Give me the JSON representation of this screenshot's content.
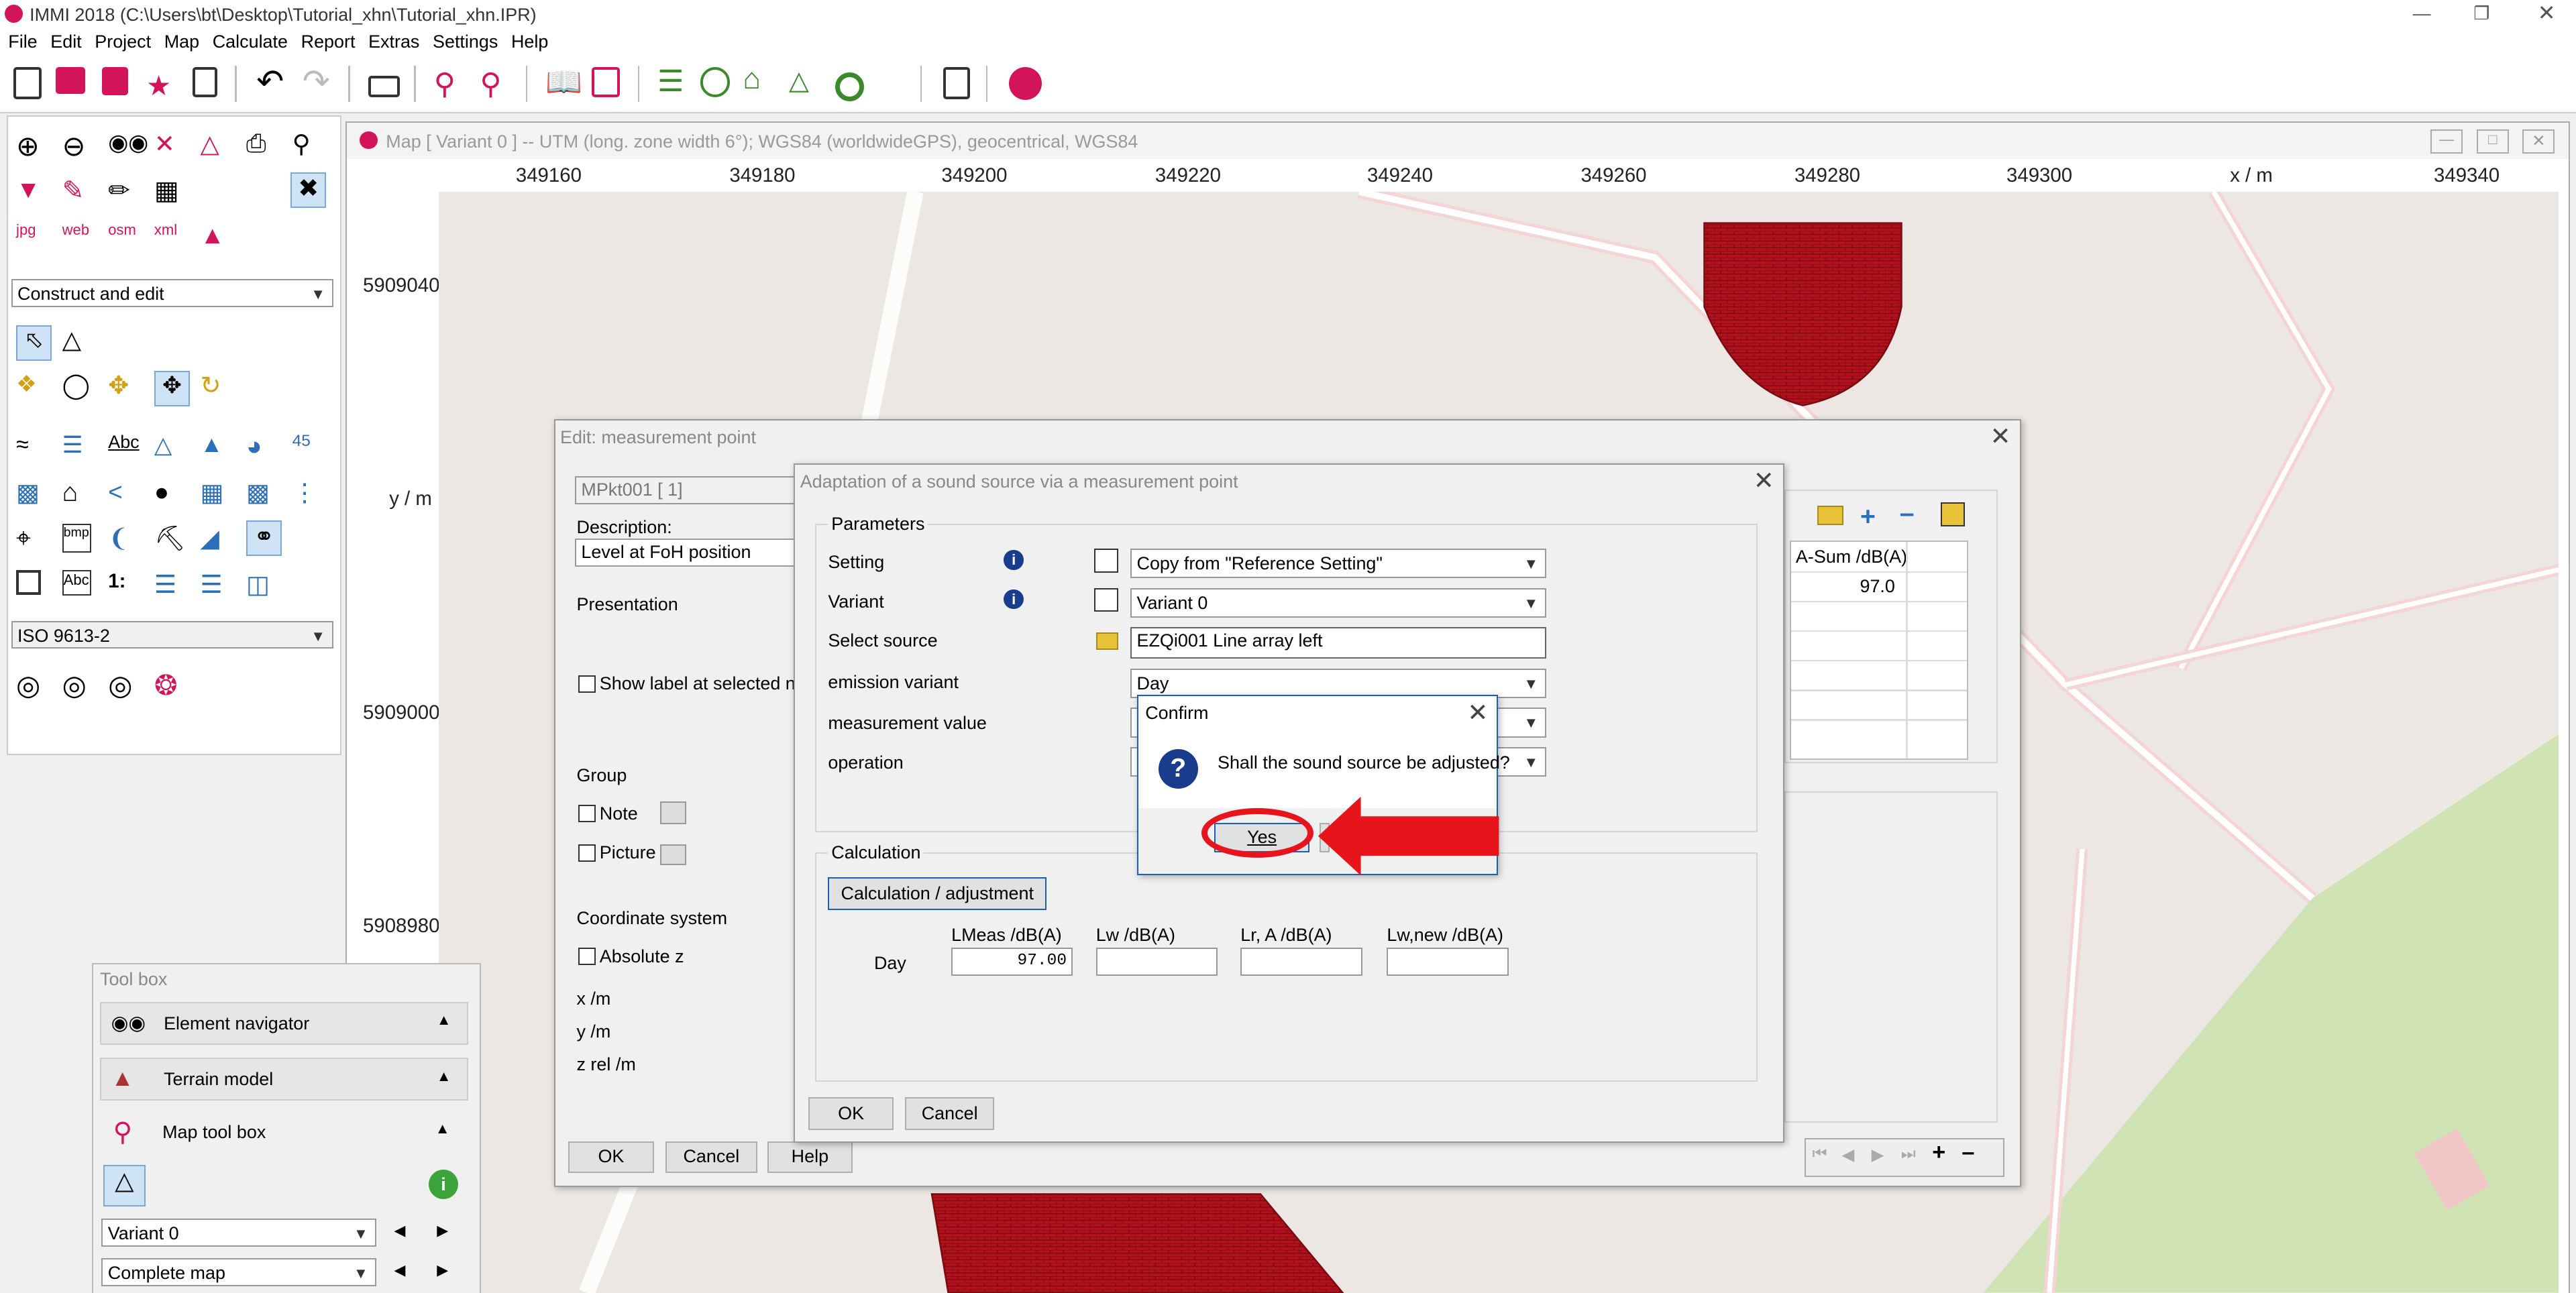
{
  "titlebar": {
    "title": "IMMI 2018 (C:\\Users\\bt\\Desktop\\Tutorial_xhn\\Tutorial_xhn.IPR)"
  },
  "menu": [
    "File",
    "Edit",
    "Project",
    "Map",
    "Calculate",
    "Report",
    "Extras",
    "Settings",
    "Help"
  ],
  "left_panel": {
    "mode_select": "Construct and edit",
    "standard_select": "ISO 9613-2"
  },
  "map": {
    "caption": "Map  [ Variant 0 ]  --  UTM (long. zone width 6°); WGS84 (worldwideGPS), geocentrical, WGS84",
    "x_ticks": [
      "349160",
      "349180",
      "349200",
      "349220",
      "349240",
      "349260",
      "349280",
      "349300",
      "x / m",
      "349340"
    ],
    "y_label": "y / m",
    "y_ticks": [
      "5909040",
      "5909000",
      "5908980"
    ]
  },
  "toolbox": {
    "title": "Tool box",
    "items": [
      "Element navigator",
      "Terrain model",
      "Map tool box"
    ],
    "variant_select": "Variant 0",
    "map_select": "Complete map"
  },
  "edit_dialog": {
    "title": "Edit:  measurement point",
    "id_field": "MPkt001  [  1]",
    "description_label": "Description:",
    "description_value": "Level at FoH position",
    "presentation_label": "Presentation",
    "show_label": "Show label at selected noc",
    "group_label": "Group",
    "note_label": "Note",
    "picture_label": "Picture",
    "coord_label": "Coordinate system",
    "absz_label": "Absolute z",
    "x_label": "x /m",
    "y_label": "y /m",
    "z_label": "z rel /m",
    "table_header": "A-Sum /dB(A)",
    "table_value": "97.0",
    "ok": "OK",
    "cancel": "Cancel",
    "help": "Help"
  },
  "adapt_dialog": {
    "title": "Adaptation of a sound source via a measurement point",
    "params_label": "Parameters",
    "setting_label": "Setting",
    "setting_value": "Copy from \"Reference Setting\"",
    "variant_label": "Variant",
    "variant_value": "Variant 0",
    "source_label": "Select source",
    "source_value": "EZQi001   Line array left",
    "emission_label": "emission variant",
    "emission_value": "Day",
    "mvalue_label": "measurement value",
    "operation_label": "operation",
    "calc_label": "Calculation",
    "calc_button": "Calculation / adjustment",
    "col_lmeas": "LMeas /dB(A)",
    "col_lw": "Lw /dB(A)",
    "col_lr": "Lr, A /dB(A)",
    "col_lwnew": "Lw,new /dB(A)",
    "row_day": "Day",
    "lmeas_value": "97.00",
    "ok": "OK",
    "cancel": "Cancel"
  },
  "confirm_dialog": {
    "title": "Confirm",
    "message": "Shall the sound source be adjusted?",
    "yes": "Yes"
  },
  "colors": {
    "accent": "#d4145a",
    "highlight_red": "#e8141c",
    "building": "#b3121d",
    "green": "#cfe3b4"
  }
}
